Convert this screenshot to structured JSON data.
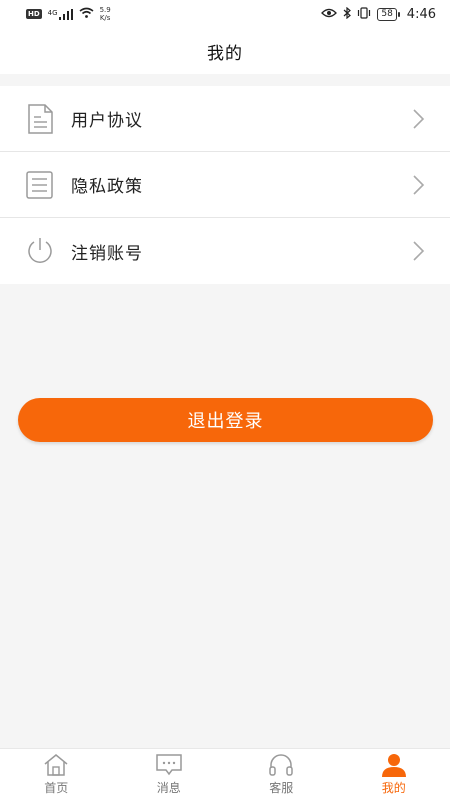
{
  "status_bar": {
    "hd": "HD",
    "signal": "4G",
    "net_speed_value": "5.9",
    "net_speed_unit": "K/s",
    "battery": "58",
    "time": "4:46"
  },
  "header": {
    "title": "我的"
  },
  "menu": [
    {
      "label": "用户协议",
      "icon": "document-icon"
    },
    {
      "label": "隐私政策",
      "icon": "list-document-icon"
    },
    {
      "label": "注销账号",
      "icon": "power-icon"
    }
  ],
  "logout_label": "退出登录",
  "bottom_nav": [
    {
      "label": "首页",
      "icon": "home-icon",
      "active": false
    },
    {
      "label": "消息",
      "icon": "message-icon",
      "active": false
    },
    {
      "label": "客服",
      "icon": "headset-icon",
      "active": false
    },
    {
      "label": "我的",
      "icon": "person-icon",
      "active": true
    }
  ],
  "colors": {
    "accent": "#f7670a",
    "icon_gray": "#9a9a9a"
  }
}
